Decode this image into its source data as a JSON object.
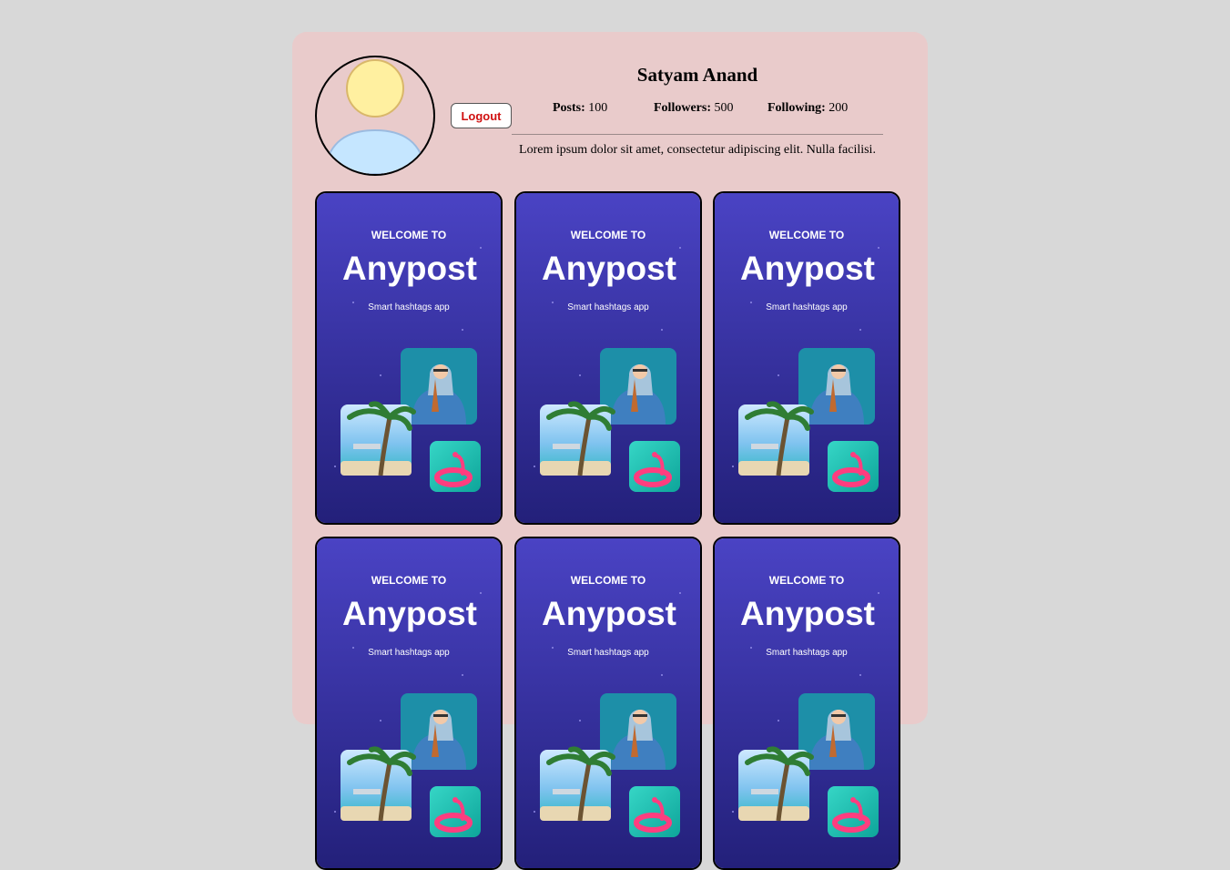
{
  "profile": {
    "name": "Satyam Anand",
    "logout_label": "Logout",
    "posts_label": "Posts:",
    "posts_value": "100",
    "followers_label": "Followers:",
    "followers_value": "500",
    "following_label": "Following:",
    "following_value": "200",
    "bio": "Lorem ipsum dolor sit amet, consectetur adipiscing elit. Nulla facilisi."
  },
  "posts": [
    {
      "welcome": "WELCOME TO",
      "brand": "Anypost",
      "tagline": "Smart hashtags app"
    },
    {
      "welcome": "WELCOME TO",
      "brand": "Anypost",
      "tagline": "Smart hashtags app"
    },
    {
      "welcome": "WELCOME TO",
      "brand": "Anypost",
      "tagline": "Smart hashtags app"
    },
    {
      "welcome": "WELCOME TO",
      "brand": "Anypost",
      "tagline": "Smart hashtags app"
    },
    {
      "welcome": "WELCOME TO",
      "brand": "Anypost",
      "tagline": "Smart hashtags app"
    },
    {
      "welcome": "WELCOME TO",
      "brand": "Anypost",
      "tagline": "Smart hashtags app"
    }
  ],
  "colors": {
    "page_bg": "#d8d8d8",
    "card_bg": "#e9cbcb",
    "post_bg_top": "#4a43c4",
    "post_bg_bottom": "#23207a",
    "logout_text": "#d01010"
  }
}
